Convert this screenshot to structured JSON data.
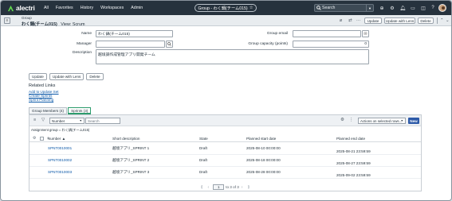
{
  "nav": {
    "logo": "alectri",
    "links": [
      "All",
      "Favorites",
      "History",
      "Workspaces",
      "Admin"
    ],
    "record_pill": "Group - わく鍋(チーム015)",
    "search_placeholder": "Search"
  },
  "header": {
    "type": "Group",
    "title": "わく鍋(チーム015)",
    "view": "View: Scrum",
    "buttons": {
      "update": "Update",
      "update_with_lens": "Update with Lens",
      "delete": "Delete"
    }
  },
  "form": {
    "name_label": "Name",
    "name_value": "わく鍋(チーム015)",
    "manager_label": "Manager",
    "manager_value": "",
    "group_email_label": "Group email",
    "group_email_value": "",
    "capacity_label": "Group capacity (points)",
    "capacity_value": "0",
    "description_label": "Description",
    "description_value": "越境調作成管理アプリ開発チーム"
  },
  "form_buttons": {
    "update": "Update",
    "update_with_lens": "Update with Lens",
    "delete": "Delete"
  },
  "related_links": {
    "heading": "Related Links",
    "links": [
      "Add to Update Set",
      "Create Sprints",
      "Sprint Planning"
    ]
  },
  "tabs": [
    {
      "label": "Group Members (4)"
    },
    {
      "label": "Sprints (3)"
    }
  ],
  "list": {
    "filter_field": "Number",
    "search_placeholder": "Search",
    "actions_placeholder": "Actions on selected rows...",
    "new_button": "New",
    "breadcrumb": "Assignment group = わく鍋(チーム015)",
    "columns": {
      "number": "Number ▲",
      "short_description": "Short description",
      "state": "State",
      "planned_start": "Planned start date",
      "planned_end": "Planned end date"
    },
    "rows": [
      {
        "number": "SPNT0010001",
        "short_description": "越境アプリ_SPRINT 1",
        "state": "Draft",
        "planned_start": "2025-08-10 00:00:00",
        "planned_end": "2025-08-21 23:59:59"
      },
      {
        "number": "SPNT0010002",
        "short_description": "越境アプリ_SPRINT 2",
        "state": "Draft",
        "planned_start": "2025-08-18 00:00:00",
        "planned_end": "2025-08-27 23:59:59"
      },
      {
        "number": "SPNT0010003",
        "short_description": "越境アプリ_SPRINT 3",
        "state": "Draft",
        "planned_start": "2025-08-28 00:00:00",
        "planned_end": "2025-09-02 23:59:59"
      }
    ],
    "pager": {
      "page": "1",
      "range": "to 3 of 3"
    }
  },
  "colors": {
    "nav_bg": "#26323d",
    "link": "#0b58a8",
    "new_button": "#2d5aa8",
    "active_tab": "#2d9c6d"
  }
}
